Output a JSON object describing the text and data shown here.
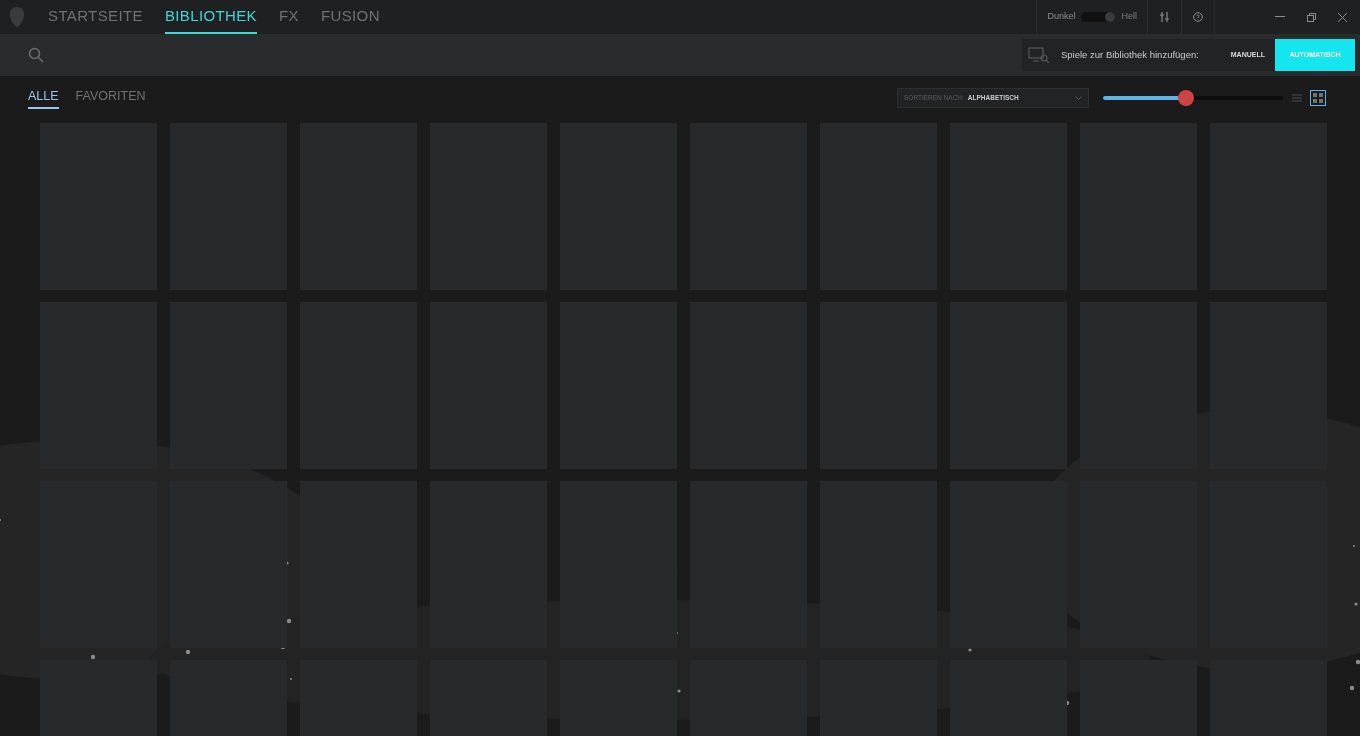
{
  "nav": {
    "tabs": [
      {
        "label": "STARTSEITE",
        "selected": false
      },
      {
        "label": "BIBLIOTHEK",
        "selected": true
      },
      {
        "label": "FX",
        "selected": false
      },
      {
        "label": "FUSION",
        "selected": false
      }
    ]
  },
  "theme_toggle": {
    "left_label": "Dunkel",
    "right_label": "Hell",
    "on": true
  },
  "add_games": {
    "label": "Spiele zur Bibliothek hinzufügen:",
    "buttons": [
      {
        "label": "MANUELL",
        "selected": false
      },
      {
        "label": "AUTOMATISCH",
        "selected": true
      }
    ]
  },
  "filters": [
    {
      "label": "ALLE",
      "selected": true
    },
    {
      "label": "FAVORITEN",
      "selected": false
    }
  ],
  "sort": {
    "prefix": "SORTIEREN NACH:",
    "value": "ALPHABETISCH"
  },
  "size_slider": {
    "level": 0.46
  },
  "views": [
    {
      "kind": "list",
      "selected": false
    },
    {
      "kind": "grid",
      "selected": true
    }
  ],
  "tiles": [
    {
      "kind": "placeholder"
    },
    {
      "kind": "placeholder"
    },
    {
      "kind": "placeholder"
    },
    {
      "kind": "placeholder"
    },
    {
      "kind": "placeholder"
    },
    {
      "kind": "placeholder"
    },
    {
      "kind": "placeholder"
    },
    {
      "kind": "placeholder"
    },
    {
      "kind": "placeholder"
    },
    {
      "kind": "placeholder"
    },
    {
      "kind": "placeholder"
    },
    {
      "kind": "placeholder"
    },
    {
      "kind": "placeholder"
    },
    {
      "kind": "placeholder"
    },
    {
      "kind": "placeholder"
    },
    {
      "kind": "placeholder"
    },
    {
      "kind": "placeholder"
    },
    {
      "kind": "placeholder"
    },
    {
      "kind": "placeholder"
    },
    {
      "kind": "placeholder"
    },
    {
      "kind": "placeholder"
    },
    {
      "kind": "placeholder"
    },
    {
      "kind": "placeholder"
    },
    {
      "kind": "placeholder"
    },
    {
      "kind": "placeholder"
    },
    {
      "kind": "placeholder"
    },
    {
      "kind": "placeholder"
    },
    {
      "kind": "placeholder"
    },
    {
      "kind": "placeholder"
    },
    {
      "kind": "placeholder"
    },
    {
      "kind": "placeholder"
    },
    {
      "kind": "placeholder"
    },
    {
      "kind": "placeholder"
    },
    {
      "kind": "placeholder"
    },
    {
      "kind": "placeholder"
    },
    {
      "kind": "placeholder"
    },
    {
      "kind": "placeholder"
    },
    {
      "kind": "placeholder"
    },
    {
      "kind": "placeholder"
    },
    {
      "kind": "placeholder"
    }
  ]
}
